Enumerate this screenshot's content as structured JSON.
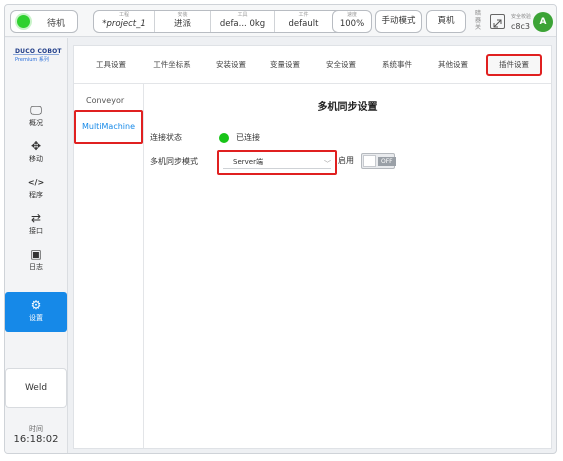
{
  "topbar": {
    "status": "待机",
    "project": {
      "label": "工程",
      "value": "*project_1"
    },
    "install": {
      "label": "安装",
      "value": "进派"
    },
    "tool": {
      "label": "工具",
      "value": "defa... 0kg"
    },
    "workpiece": {
      "label": "工件",
      "value": "default"
    },
    "speed": {
      "label": "速度",
      "value": "100%"
    },
    "manual_mode": "手动模式",
    "rear_button": "頁机",
    "mini_text_1": "暗",
    "mini_text_2": "器",
    "mini_text_3": "关",
    "safety_label": "安全校验",
    "safety_value": "c8c3",
    "avatar_letter": "A"
  },
  "leftnav": {
    "logo_main": "DUCO COBOT",
    "logo_sub": "Premium 系列",
    "items": [
      {
        "label": "概况",
        "icon": "monitor-icon"
      },
      {
        "label": "移动",
        "icon": "move-icon"
      },
      {
        "label": "程序",
        "icon": "code-icon"
      },
      {
        "label": "接口",
        "icon": "io-icon"
      },
      {
        "label": "日志",
        "icon": "calendar-icon"
      },
      {
        "label": "设置",
        "icon": "gear-icon"
      }
    ],
    "icons": {
      "monitor": "🖵",
      "move": "✥",
      "code": "</>",
      "io": "⇄",
      "calendar": "▣",
      "gear": "⚙"
    },
    "weld": "Weld",
    "time_label": "时间",
    "time_value": "16:18:02"
  },
  "tabs": [
    "工具设置",
    "工件坐标系",
    "安装设置",
    "变量设置",
    "安全设置",
    "系统事件",
    "其他设置",
    "插件设置"
  ],
  "plugins": [
    "Conveyor",
    "MultiMachine"
  ],
  "main": {
    "title": "多机同步设置",
    "connection_label": "连接状态",
    "connection_status": "已连接",
    "mode_label": "多机同步模式",
    "mode_value": "Server端",
    "mode_chevron": "﹀",
    "enable_label": "启用",
    "toggle_text": "OFF"
  },
  "colors": {
    "accent": "#1689e8",
    "highlight": "#e02020",
    "status_green": "#2fd12f",
    "avatar": "#3ca336"
  }
}
